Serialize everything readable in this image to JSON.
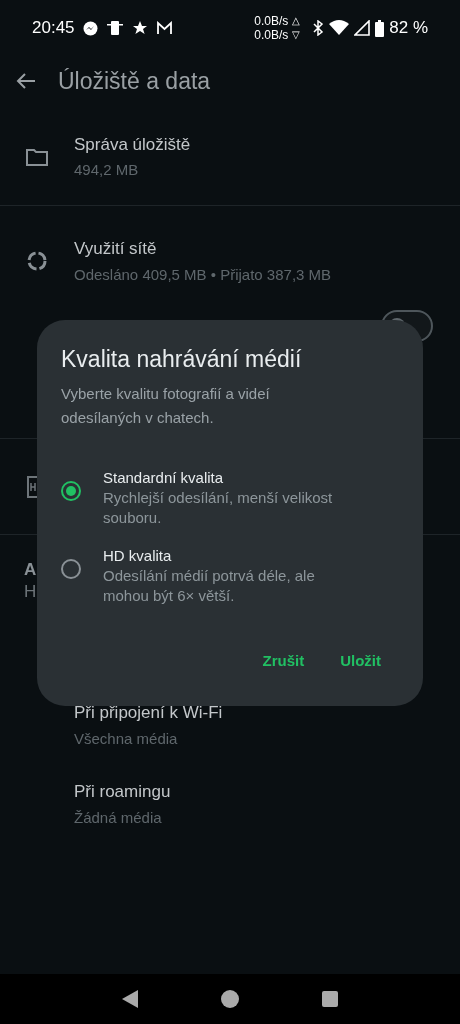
{
  "status_bar": {
    "time": "20:45",
    "net_up": "0.0B/s",
    "up_arrow": "△",
    "net_down": "0.0B/s",
    "down_arrow": "▽",
    "battery": "82 %"
  },
  "app_bar": {
    "title": "Úložiště a data"
  },
  "storage_items": [
    {
      "title": "Správa úložiště",
      "subtitle": "494,2 MB"
    },
    {
      "title": "Využití sítě",
      "subtitle": "Odesláno 409,5 MB • Přijato 387,3 MB"
    }
  ],
  "toggle_row": {
    "on": false
  },
  "section": {
    "header": "A",
    "item": "H"
  },
  "auto_download": [
    {
      "title": "Při připojení k Wi-Fi",
      "subtitle": "Všechna média"
    },
    {
      "title": "Při roamingu",
      "subtitle": "Žádná média"
    }
  ],
  "dialog": {
    "title": "Kvalita nahrávání médií",
    "description": "Vyberte kvalitu fotografií a videí odesílaných v chatech.",
    "options": [
      {
        "label": "Standardní kvalita",
        "description": "Rychlejší odesílání, menší velikost souboru.",
        "selected": true
      },
      {
        "label": "HD kvalita",
        "description": "Odesílání médií potrvá déle, ale mohou být 6× větší.",
        "selected": false
      }
    ],
    "buttons": [
      "Zrušit",
      "Uložit"
    ]
  }
}
